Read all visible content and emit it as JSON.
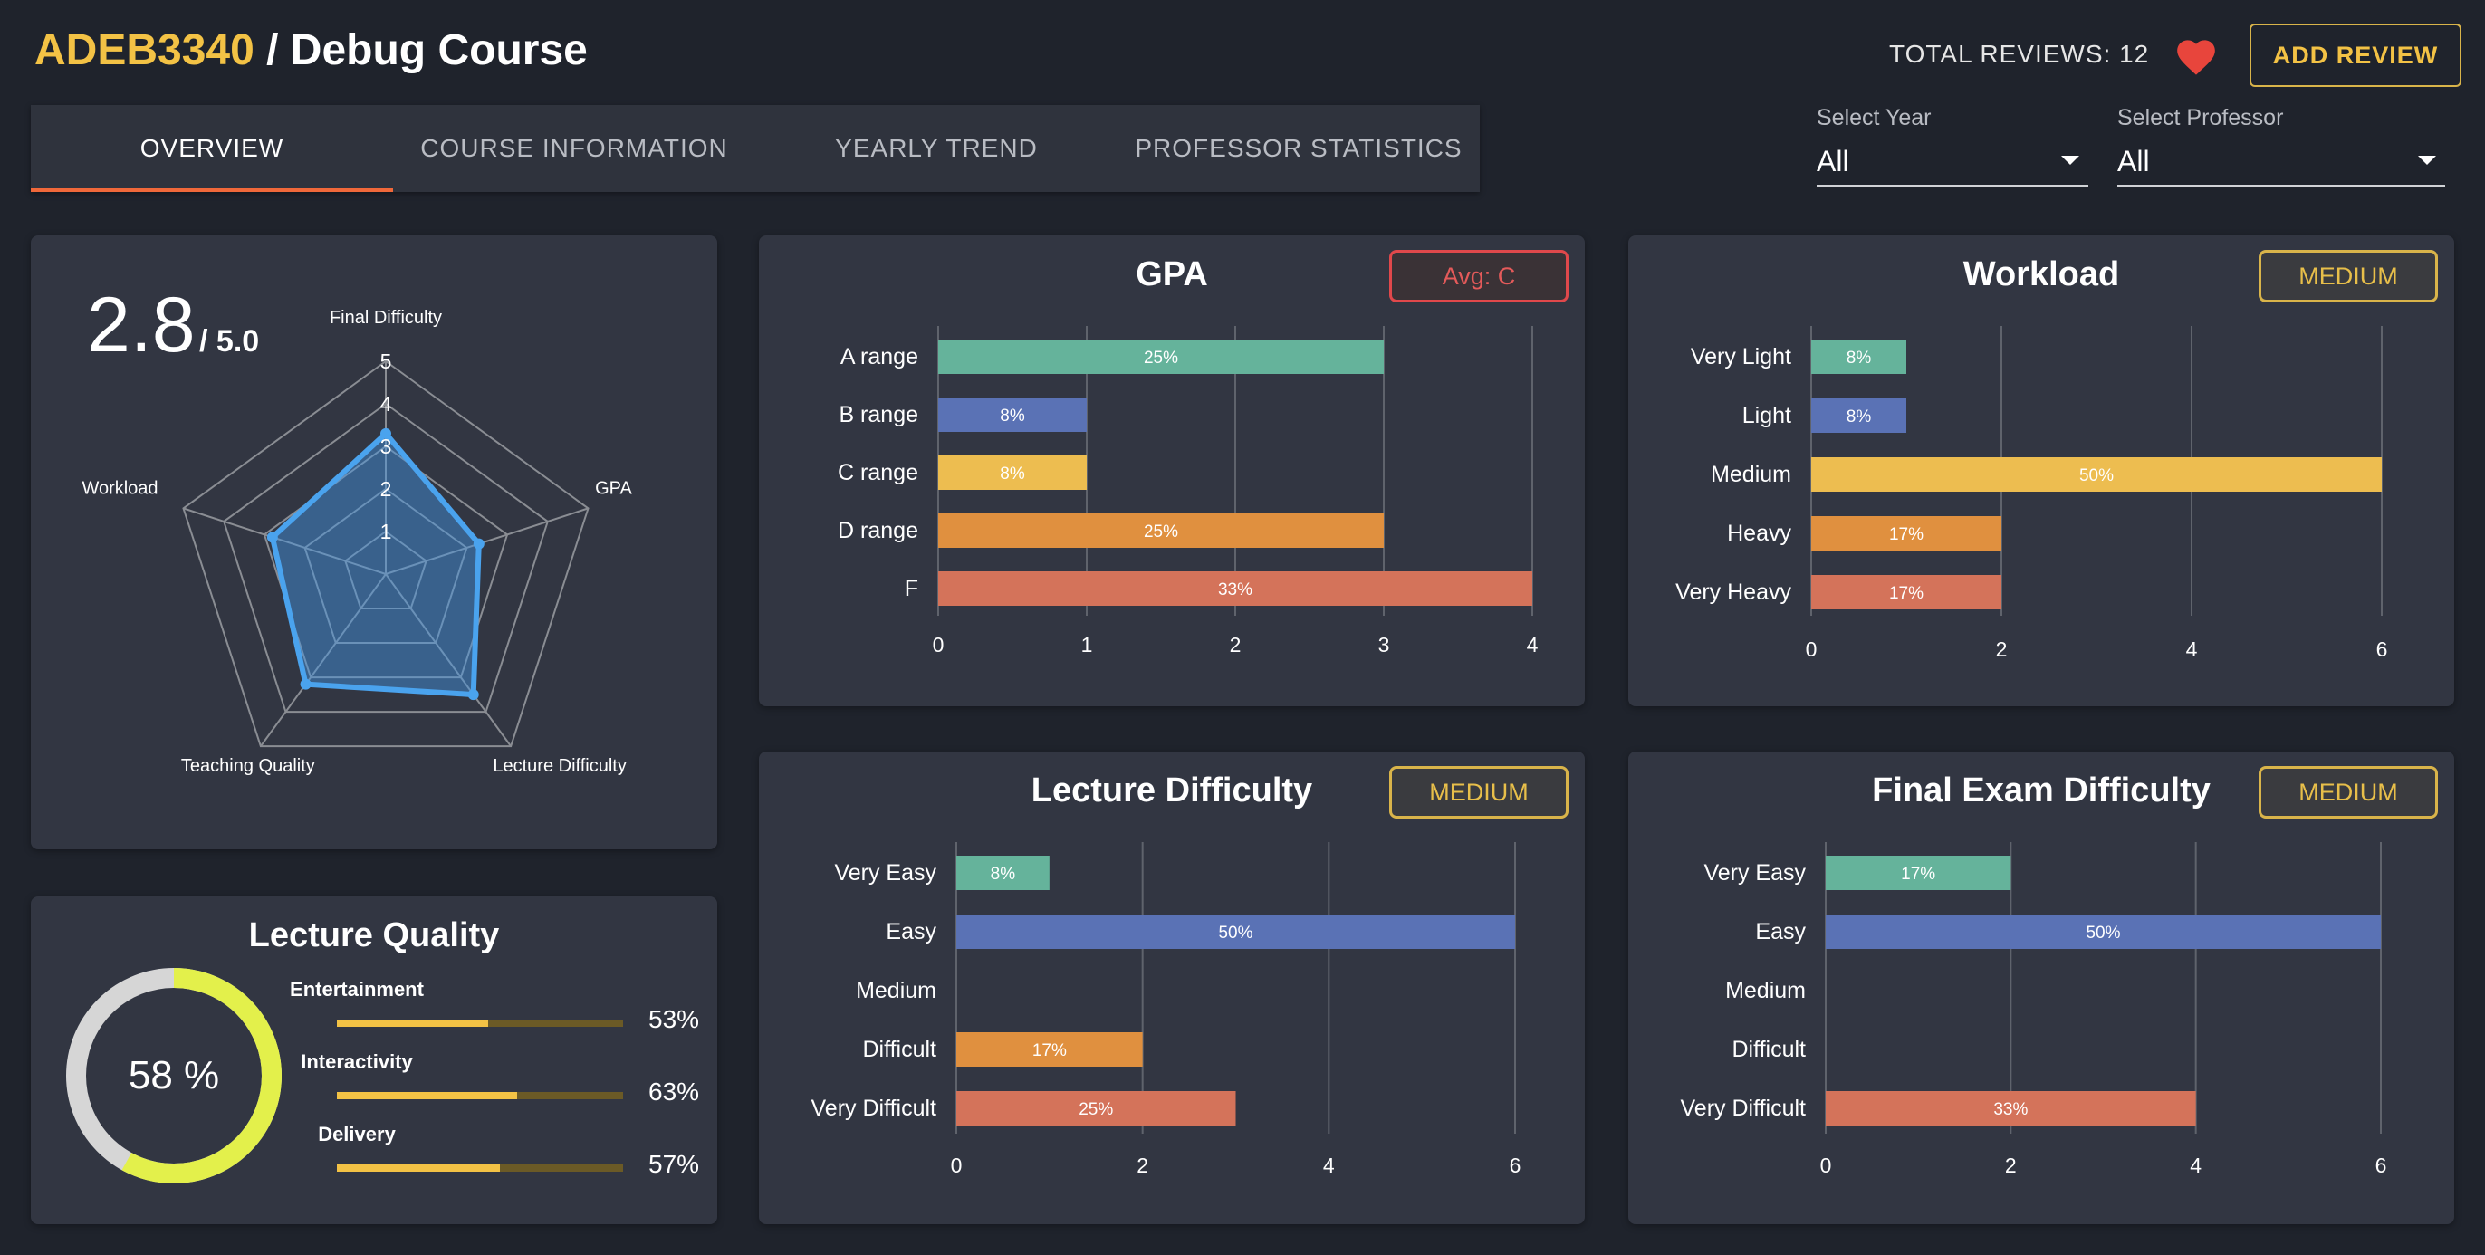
{
  "header": {
    "course_code": "ADEB3340",
    "course_rest": " / Debug Course",
    "total_reviews": "TOTAL REVIEWS: 12",
    "add_review_label": "ADD REVIEW"
  },
  "tabs": [
    {
      "label": "OVERVIEW",
      "active": true
    },
    {
      "label": "COURSE INFORMATION",
      "active": false
    },
    {
      "label": "YEARLY TREND",
      "active": false
    },
    {
      "label": "PROFESSOR STATISTICS",
      "active": false
    }
  ],
  "filters": {
    "year_label": "Select Year",
    "year_value": "All",
    "professor_label": "Select Professor",
    "professor_value": "All"
  },
  "colors": {
    "accent": "#f3c245",
    "tab_indicator": "#f0683a",
    "heart": "#e8453c",
    "green": "#65b39b",
    "blue": "#5a72b5",
    "yellow": "#edbd50",
    "orange": "#e0903f",
    "red": "#d4735a"
  },
  "overall": {
    "score": "2.8",
    "max": "/ 5.0"
  },
  "lecture_quality": {
    "title": "Lecture Quality",
    "overall_pct": 58,
    "overall_text": "58 %",
    "items": [
      {
        "label": "Entertainment",
        "value": 53,
        "text": "53%"
      },
      {
        "label": "Interactivity",
        "value": 63,
        "text": "63%"
      },
      {
        "label": "Delivery",
        "value": 57,
        "text": "57%"
      }
    ]
  },
  "cards": {
    "gpa": {
      "title": "GPA",
      "badge": "Avg: C"
    },
    "workload": {
      "title": "Workload",
      "badge": "MEDIUM"
    },
    "lecture": {
      "title": "Lecture Difficulty",
      "badge": "MEDIUM"
    },
    "final": {
      "title": "Final Exam Difficulty",
      "badge": "MEDIUM"
    }
  },
  "chart_data": [
    {
      "type": "radar",
      "axes": [
        "Final Difficulty",
        "GPA",
        "Lecture Difficulty",
        "Teaching Quality",
        "Workload"
      ],
      "values": [
        3.3,
        2.3,
        3.5,
        3.2,
        2.8
      ],
      "ticks": [
        "1",
        "2",
        "3",
        "4",
        "5"
      ],
      "range": [
        0,
        5
      ]
    },
    {
      "type": "bar",
      "orientation": "horizontal",
      "title": "GPA",
      "categories": [
        "A range",
        "B range",
        "C range",
        "D range",
        "F"
      ],
      "values": [
        3,
        1,
        1,
        3,
        4
      ],
      "labels": [
        "25%",
        "8%",
        "8%",
        "25%",
        "33%"
      ],
      "ticks": [
        0,
        1,
        2,
        3,
        4
      ],
      "xlim": [
        0,
        4
      ]
    },
    {
      "type": "bar",
      "orientation": "horizontal",
      "title": "Workload",
      "categories": [
        "Very Light",
        "Light",
        "Medium",
        "Heavy",
        "Very Heavy"
      ],
      "values": [
        1,
        1,
        6,
        2,
        2
      ],
      "labels": [
        "8%",
        "8%",
        "50%",
        "17%",
        "17%"
      ],
      "ticks": [
        0,
        2,
        4,
        6
      ],
      "xlim": [
        0,
        6
      ]
    },
    {
      "type": "bar",
      "orientation": "horizontal",
      "title": "Lecture Difficulty",
      "categories": [
        "Very Easy",
        "Easy",
        "Medium",
        "Difficult",
        "Very Difficult"
      ],
      "values": [
        1,
        6,
        0,
        2,
        3
      ],
      "labels": [
        "8%",
        "50%",
        "",
        "17%",
        "25%"
      ],
      "ticks": [
        0,
        2,
        4,
        6
      ],
      "xlim": [
        0,
        6
      ]
    },
    {
      "type": "bar",
      "orientation": "horizontal",
      "title": "Final Exam Difficulty",
      "categories": [
        "Very Easy",
        "Easy",
        "Medium",
        "Difficult",
        "Very Difficult"
      ],
      "values": [
        2,
        6,
        0,
        0,
        4
      ],
      "labels": [
        "17%",
        "50%",
        "",
        "",
        "33%"
      ],
      "ticks": [
        0,
        2,
        4,
        6
      ],
      "xlim": [
        0,
        6
      ]
    }
  ]
}
